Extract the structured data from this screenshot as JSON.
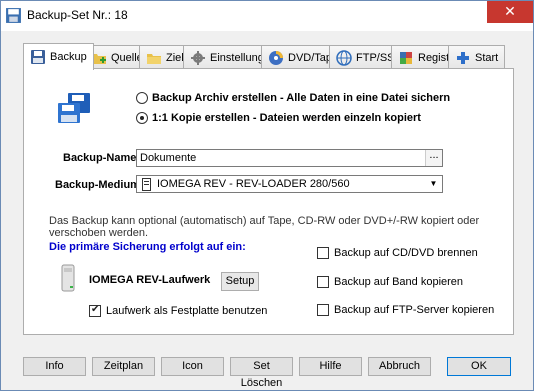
{
  "window": {
    "title": "Backup-Set Nr.: 18",
    "close_glyph": "✕"
  },
  "tabs": [
    {
      "label": "Backup",
      "icon": "floppy-icon",
      "active": true
    },
    {
      "label": "Quelle",
      "icon": "folder-add-icon"
    },
    {
      "label": "Ziel",
      "icon": "folder-icon"
    },
    {
      "label": "Einstellungen",
      "icon": "gear-icon"
    },
    {
      "label": "DVD/Tape",
      "icon": "disc-icon"
    },
    {
      "label": "FTP/SSH",
      "icon": "globe-icon"
    },
    {
      "label": "Registry",
      "icon": "registry-icon"
    },
    {
      "label": "Start",
      "icon": "plus-icon"
    }
  ],
  "mode": {
    "option_archive": "Backup Archiv erstellen - Alle Daten in eine Datei sichern",
    "option_copy": "1:1 Kopie erstellen - Dateien werden einzeln kopiert",
    "selected": "copy"
  },
  "backup_name": {
    "label": "Backup-Name:",
    "value": "Dokumente",
    "browse": "..."
  },
  "backup_medium": {
    "label": "Backup-Medium:",
    "value": "IOMEGA REV - REV-LOADER 280/560"
  },
  "info_text": "Das Backup kann optional (automatisch) auf Tape, CD-RW oder DVD+/-RW kopiert oder verschoben werden.",
  "primary": {
    "title": "Die primäre Sicherung erfolgt auf ein:",
    "drive_label": "IOMEGA REV-Laufwerk",
    "setup_label": "Setup",
    "use_as_disk_label": "Laufwerk als Festplatte benutzen",
    "use_as_disk_checked": true
  },
  "options": [
    {
      "label": "Backup auf CD/DVD brennen",
      "checked": false
    },
    {
      "label": "Backup auf Band kopieren",
      "checked": false
    },
    {
      "label": "Backup auf FTP-Server kopieren",
      "checked": false
    }
  ],
  "buttons": {
    "info": "Info",
    "schedule": "Zeitplan",
    "icon": "Icon",
    "delete_set": "Set Löschen",
    "help": "Hilfe",
    "cancel": "Abbruch",
    "ok": "OK"
  }
}
